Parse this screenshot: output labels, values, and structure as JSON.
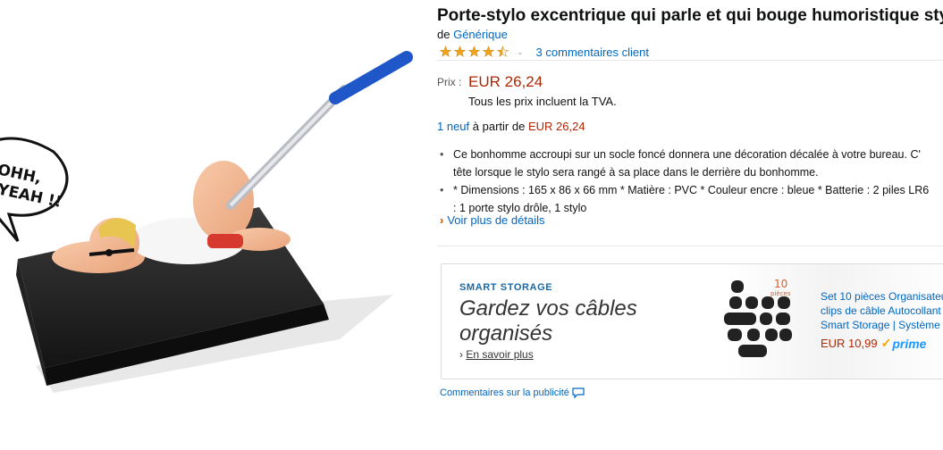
{
  "product": {
    "title": "Porte-stylo excentrique qui parle et qui bouge humoristique stylo",
    "by_prefix": "de",
    "brand": "Générique",
    "rating": 4.5,
    "review_count": "3 commentaires client",
    "price_label": "Prix :",
    "price": "EUR 26,24",
    "vat_note": "Tous les prix incluent la TVA.",
    "offers_count": "1 neuf",
    "offers_text": "à partir de",
    "offers_price": "EUR 26,24",
    "bullets": [
      {
        "line1": "Ce bonhomme accroupi sur un socle foncé donnera une décoration décalée à votre bureau. C'",
        "line2": "tête lorsque le stylo sera rangé à sa place dans le derrière du bonhomme."
      },
      {
        "line1": "* Dimensions : 165 x 86 x 66 mm * Matière : PVC * Couleur encre : bleue * Batterie : 2 piles LR6",
        "line2": ": 1 porte stylo drôle, 1 stylo"
      }
    ],
    "more_details": "Voir plus de détails",
    "image_bubble_line1": "OHH,",
    "image_bubble_line2": "YEAH !!"
  },
  "ad": {
    "brand": "SMART STORAGE",
    "headline": "Gardez vos câbles organisés",
    "cta": "En savoir plus",
    "badge_number": "10",
    "badge_text": "pièces",
    "desc_line1": "Set 10 pièces Organisateu",
    "desc_line2": "clips de câble Autocollant",
    "desc_line3": "Smart Storage | Système d",
    "price": "EUR 10,99",
    "prime": "prime",
    "feedback": "Commentaires sur la publicité"
  },
  "colors": {
    "link": "#0066c0",
    "price": "#b12704",
    "star": "#f0a41c",
    "pen_blue": "#1f56c8"
  }
}
